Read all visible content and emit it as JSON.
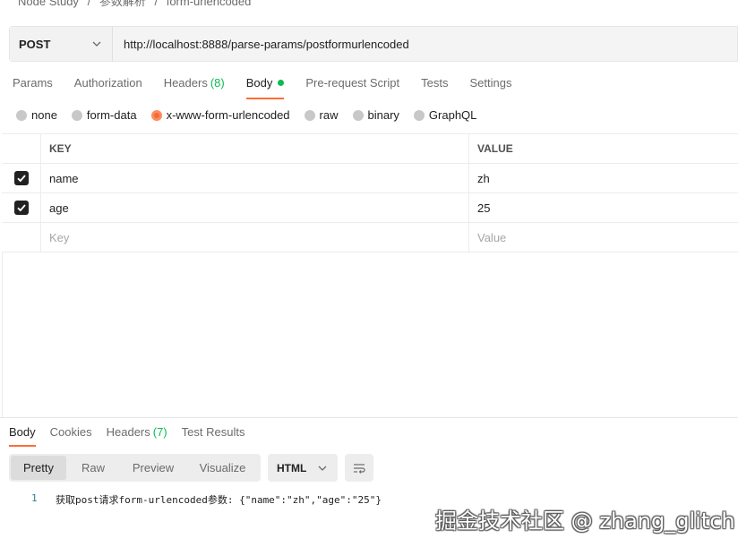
{
  "breadcrumb": [
    "Node Study",
    "/",
    "参数解析",
    "/",
    "form-urlencoded"
  ],
  "request": {
    "method": "POST",
    "url": "http://localhost:8888/parse-params/postformurlencoded"
  },
  "request_tabs": [
    {
      "label": "Params"
    },
    {
      "label": "Authorization"
    },
    {
      "label": "Headers",
      "count": "(8)"
    },
    {
      "label": "Body",
      "active": true
    },
    {
      "label": "Pre-request Script"
    },
    {
      "label": "Tests"
    },
    {
      "label": "Settings"
    }
  ],
  "body_types": [
    "none",
    "form-data",
    "x-www-form-urlencoded",
    "raw",
    "binary",
    "GraphQL"
  ],
  "body_type_selected": "x-www-form-urlencoded",
  "table": {
    "headers": {
      "key": "KEY",
      "value": "VALUE"
    },
    "rows": [
      {
        "key": "name",
        "value": "zh",
        "checked": true
      },
      {
        "key": "age",
        "value": "25",
        "checked": true
      }
    ],
    "placeholder": {
      "key": "Key",
      "value": "Value"
    }
  },
  "response_tabs": [
    {
      "label": "Body",
      "active": true
    },
    {
      "label": "Cookies"
    },
    {
      "label": "Headers",
      "count": "(7)"
    },
    {
      "label": "Test Results"
    }
  ],
  "view_modes": [
    "Pretty",
    "Raw",
    "Preview",
    "Visualize"
  ],
  "view_mode_active": "Pretty",
  "format": "HTML",
  "response_body": {
    "line_number": "1",
    "text": "获取post请求form-urlencoded参数: {\"name\":\"zh\",\"age\":\"25\"}"
  },
  "watermark": "掘金技术社区 @ zhang_glitch",
  "colors": {
    "accent": "#ff6c37",
    "success": "#0cbb52"
  },
  "icons": [
    "chevron-down-icon",
    "checkmark-icon",
    "wrap-lines-icon"
  ]
}
